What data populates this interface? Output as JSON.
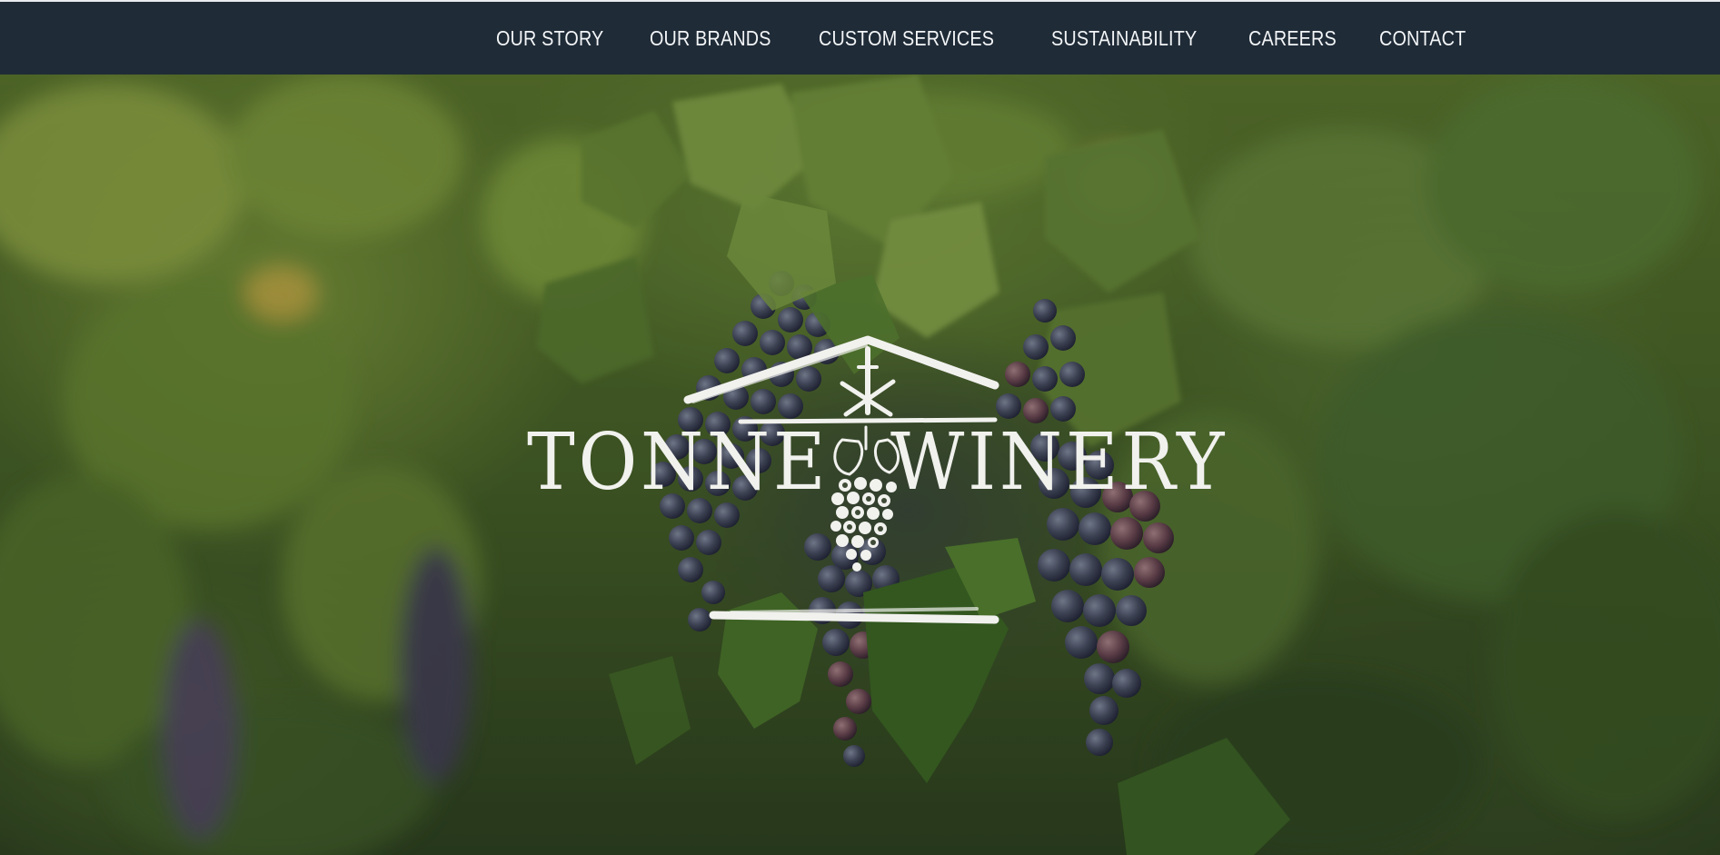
{
  "nav": {
    "items": [
      {
        "label": "OUR STORY"
      },
      {
        "label": "OUR BRANDS"
      },
      {
        "label": "CUSTOM SERVICES"
      },
      {
        "label": "SUSTAINABILITY"
      },
      {
        "label": "CAREERS"
      },
      {
        "label": "CONTACT"
      }
    ]
  },
  "hero": {
    "logo_text_left": "TONNE",
    "logo_text_right": "WINERY"
  },
  "colors": {
    "nav_background": "#1f2b37",
    "nav_text": "#f3f5f7",
    "logo": "#f1f1ee"
  }
}
